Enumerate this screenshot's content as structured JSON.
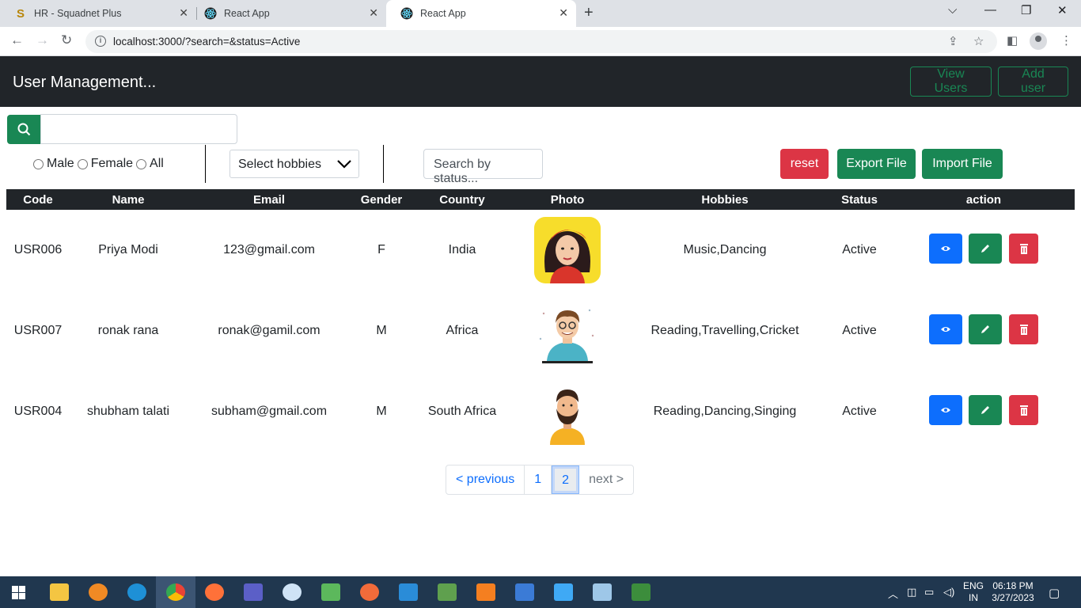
{
  "browser": {
    "tabs": [
      {
        "title": "HR - Squadnet Plus",
        "active": false
      },
      {
        "title": "React App",
        "active": false
      },
      {
        "title": "React App",
        "active": true
      }
    ],
    "url": "localhost:3000/?search=&status=Active"
  },
  "app": {
    "brand": "User Management...",
    "nav": {
      "view_users": "View Users",
      "add_user": "Add user"
    }
  },
  "filters": {
    "search_value": "",
    "gender_options": [
      "Male",
      "Female",
      "All"
    ],
    "hobbies_placeholder": "Select hobbies",
    "status_placeholder": "Search by status...",
    "reset_label": "reset",
    "export_label": "Export File",
    "import_label": "Import File"
  },
  "table": {
    "headers": [
      "Code",
      "Name",
      "Email",
      "Gender",
      "Country",
      "Photo",
      "Hobbies",
      "Status",
      "action"
    ],
    "rows": [
      {
        "code": "USR006",
        "name": "Priya Modi",
        "email": "123@gmail.com",
        "gender": "F",
        "country": "India",
        "photo": "woman-avatar",
        "hobbies": "Music,Dancing",
        "status": "Active"
      },
      {
        "code": "USR007",
        "name": "ronak rana",
        "email": "ronak@gamil.com",
        "gender": "M",
        "country": "Africa",
        "photo": "man-glasses-avatar",
        "hobbies": "Reading,Travelling,Cricket",
        "status": "Active"
      },
      {
        "code": "USR004",
        "name": "shubham talati",
        "email": "subham@gmail.com",
        "gender": "M",
        "country": "South Africa",
        "photo": "bearded-man-avatar",
        "hobbies": "Reading,Dancing,Singing",
        "status": "Active"
      }
    ]
  },
  "pagination": {
    "previous": "< previous",
    "pages": [
      "1",
      "2"
    ],
    "current": "2",
    "next": "next >"
  },
  "taskbar": {
    "lang_top": "ENG",
    "lang_bottom": "IN",
    "time": "06:18 PM",
    "date": "3/27/2023"
  },
  "colors": {
    "primary": "#0d6efd",
    "success": "#198754",
    "danger": "#dc3545",
    "dark": "#212529"
  }
}
